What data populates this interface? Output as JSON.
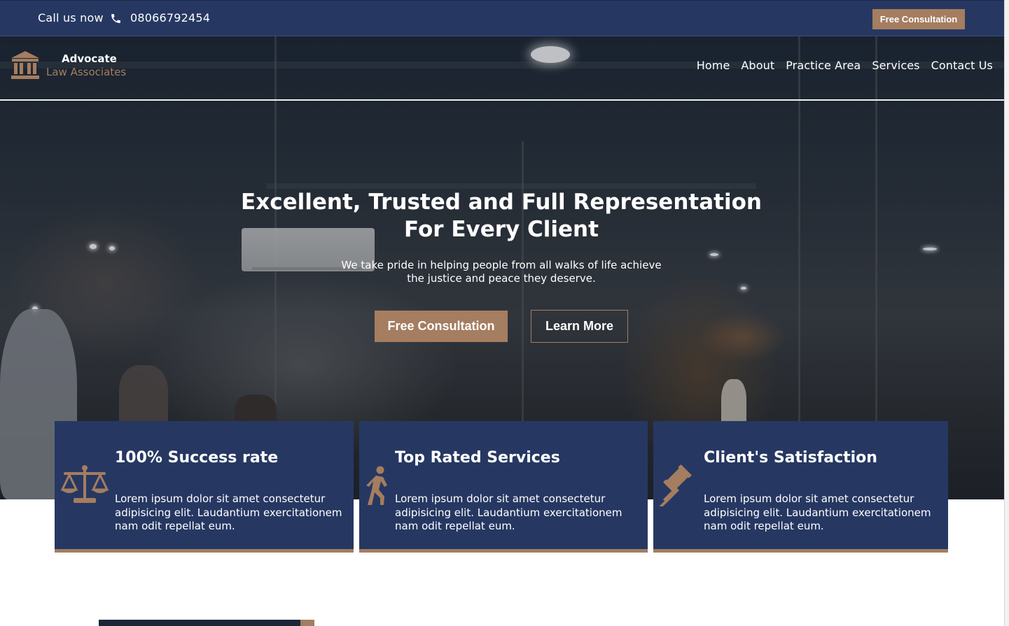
{
  "topbar": {
    "call_label": "Call us now",
    "phone_icon": "phone-icon",
    "phone": "08066792454",
    "cta_label": "Free Consultation"
  },
  "logo": {
    "icon": "courthouse-icon",
    "line1": "Advocate",
    "line2": "Law Associates"
  },
  "nav": {
    "items": [
      {
        "label": "Home"
      },
      {
        "label": "About"
      },
      {
        "label": "Practice Area"
      },
      {
        "label": "Services"
      },
      {
        "label": "Contact Us"
      }
    ]
  },
  "hero": {
    "title_line1": "Excellent, Trusted and Full Representation",
    "title_line2": "For Every Client",
    "subtitle_line1": "We take pride in helping people from all walks of life achieve",
    "subtitle_line2": "the justice and peace they deserve.",
    "primary_cta": "Free Consultation",
    "secondary_cta": "Learn More"
  },
  "features": [
    {
      "icon": "scales-icon",
      "title": "100% Success rate",
      "text": "Lorem ipsum dolor sit amet consectetur adipisicing elit. Laudantium exercitationem nam odit repellat eum."
    },
    {
      "icon": "walking-person-icon",
      "title": "Top Rated Services",
      "text": "Lorem ipsum dolor sit amet consectetur adipisicing elit. Laudantium exercitationem nam odit repellat eum."
    },
    {
      "icon": "gavel-icon",
      "title": "Client's Satisfaction",
      "text": "Lorem ipsum dolor sit amet consectetur adipisicing elit. Laudantium exercitationem nam odit repellat eum."
    }
  ],
  "colors": {
    "navy": "#263862",
    "accent": "#a57d60",
    "white": "#ffffff"
  }
}
